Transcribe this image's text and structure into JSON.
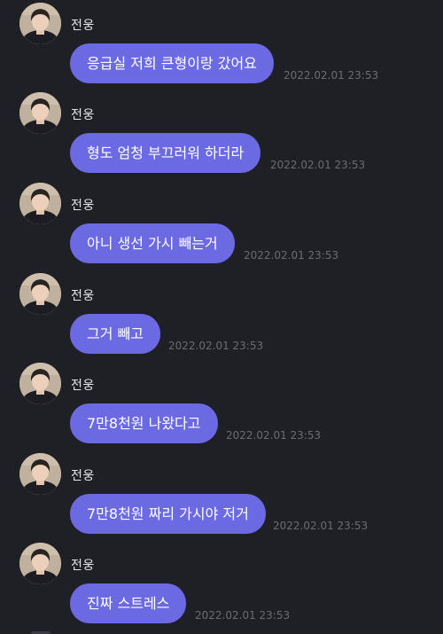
{
  "messages": [
    {
      "sender": "전웅",
      "text": "응급실 저희 큰형이랑 갔어요",
      "time": "2022.02.01 23:53"
    },
    {
      "sender": "전웅",
      "text": "형도 엄청 부끄러워 하더라",
      "time": "2022.02.01 23:53"
    },
    {
      "sender": "전웅",
      "text": "아니 생선 가시 빼는거",
      "time": "2022.02.01 23:53"
    },
    {
      "sender": "전웅",
      "text": "그거 빼고",
      "time": "2022.02.01 23:53"
    },
    {
      "sender": "전웅",
      "text": "7만8천원 나왔다고",
      "time": "2022.02.01 23:53"
    },
    {
      "sender": "전웅",
      "text": "7만8천원 짜리 가시야 저거",
      "time": "2022.02.01 23:53"
    },
    {
      "sender": "전웅",
      "text": "진짜 스트레스",
      "time": "2022.02.01 23:53"
    }
  ],
  "colors": {
    "background": "#1f1f26",
    "bubble": "#6b6ae2",
    "timestamp": "#6b6b73",
    "sender_name": "#e6e6ea"
  },
  "icons": {
    "avatar": "profile-photo"
  }
}
